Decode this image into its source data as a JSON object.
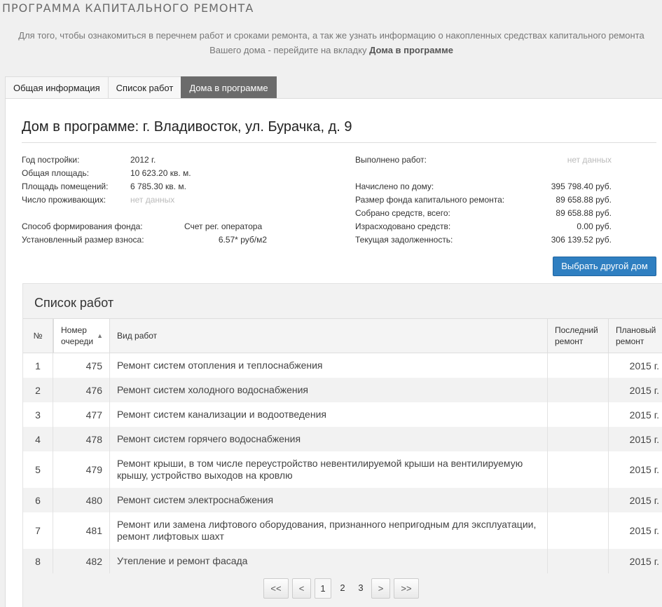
{
  "page": {
    "title": "ПРОГРАММА КАПИТАЛЬНОГО РЕМОНТА",
    "intro_text": "Для того, чтобы ознакомиться в перечнем работ и сроками ремонта, а так же узнать информацию о накопленных средствах капитального ремонта Вашего дома - перейдите на вкладку ",
    "intro_bold": "Дома в программе"
  },
  "tabs": [
    {
      "label": "Общая информация",
      "active": false
    },
    {
      "label": "Список работ",
      "active": false
    },
    {
      "label": "Дома в программе",
      "active": true
    }
  ],
  "house": {
    "title": "Дом в программе: г. Владивосток, ул. Бурачка, д. 9",
    "left": {
      "year_label": "Год постройки:",
      "year_value": "2012 г.",
      "area_label": "Общая площадь:",
      "area_value": "10 623.20 кв. м.",
      "rooms_label": "Площадь помещений:",
      "rooms_value": "6 785.30 кв. м.",
      "residents_label": "Число проживающих:",
      "residents_value": "нет данных",
      "fund_label": "Способ формирования фонда:",
      "fund_value": "Счет рег. оператора",
      "fee_label": "Установленный размер взноса:",
      "fee_value": "6.57* руб/м2"
    },
    "right": {
      "done_label": "Выполнено работ:",
      "done_value": "нет данных",
      "charged_label": "Начислено по дому:",
      "charged_value": "395 798.40 руб.",
      "fund_size_label": "Размер фонда капитального ремонта:",
      "fund_size_value": "89 658.88 руб.",
      "collected_label": "Собрано средств, всего:",
      "collected_value": "89 658.88 руб.",
      "spent_label": "Израсходовано средств:",
      "spent_value": "0.00 руб.",
      "debt_label": "Текущая задолженность:",
      "debt_value": "306 139.52 руб."
    },
    "choose_button": "Выбрать другой дом"
  },
  "works": {
    "title": "Список работ",
    "headers": {
      "num": "№",
      "queue_line1": "Номер",
      "queue_line2": "очереди",
      "queue_sort": "▲",
      "work": "Вид работ",
      "last_line1": "Последний",
      "last_line2": "ремонт",
      "plan_line1": "Плановый",
      "plan_line2": "ремонт"
    },
    "rows": [
      {
        "num": "1",
        "queue": "475",
        "work": "Ремонт систем отопления и теплоснабжения",
        "last": "",
        "plan": "2015 г."
      },
      {
        "num": "2",
        "queue": "476",
        "work": "Ремонт систем холодного водоснабжения",
        "last": "",
        "plan": "2015 г."
      },
      {
        "num": "3",
        "queue": "477",
        "work": "Ремонт систем канализации и водоотведения",
        "last": "",
        "plan": "2015 г."
      },
      {
        "num": "4",
        "queue": "478",
        "work": "Ремонт систем горячего водоснабжения",
        "last": "",
        "plan": "2015 г."
      },
      {
        "num": "5",
        "queue": "479",
        "work": "Ремонт крыши, в том числе переустройство невентилируемой крыши на вентилируемую крышу, устройство выходов на кровлю",
        "last": "",
        "plan": "2015 г."
      },
      {
        "num": "6",
        "queue": "480",
        "work": "Ремонт систем электроснабжения",
        "last": "",
        "plan": "2015 г."
      },
      {
        "num": "7",
        "queue": "481",
        "work": "Ремонт или замена лифтового оборудования, признанного непригодным для эксплуатации, ремонт лифтовых шахт",
        "last": "",
        "plan": "2015 г."
      },
      {
        "num": "8",
        "queue": "482",
        "work": "Утепление и ремонт фасада",
        "last": "",
        "plan": "2015 г."
      }
    ]
  },
  "pager": {
    "first": "<<",
    "prev": "<",
    "pages": [
      "1",
      "2",
      "3"
    ],
    "current": "1",
    "next": ">",
    "last": ">>"
  }
}
